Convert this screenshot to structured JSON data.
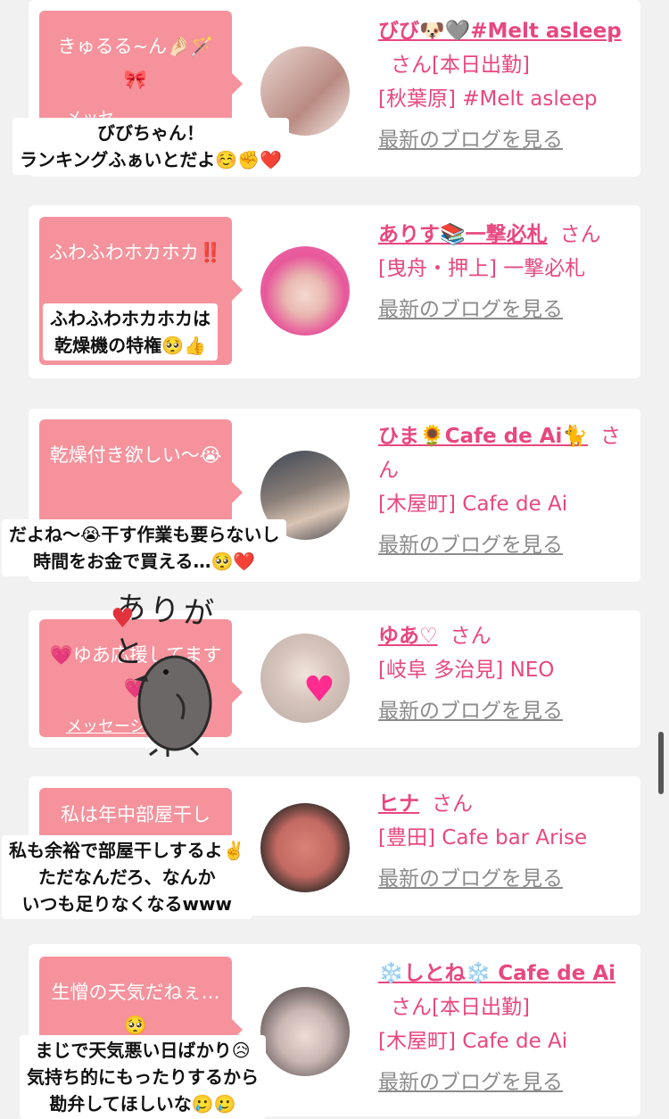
{
  "entries": [
    {
      "bubble_text": "きゅるる~ん🤌🏻🪄🎀",
      "bubble_link": "メッセ",
      "name": "びび🐶🩶#Melt asleep",
      "san": "さん[本日出勤]",
      "shop": "[秋葉原] #Melt asleep",
      "blog": "最新のブログを見る",
      "caption": "びびちゃん！\nランキングふぁいとだよ☺️✊❤️"
    },
    {
      "bubble_text": "ふわふわホカホカ‼️",
      "name": "ありす📚一撃必札",
      "san": "さん",
      "shop": "[曳舟・押上] 一撃必札",
      "blog": "最新のブログを見る",
      "caption": "ふわふわホカホカは\n乾燥機の特権🥺👍"
    },
    {
      "bubble_text": "乾燥付き欲しい〜😭",
      "name": "ひま🌻Cafe de Ai🐈",
      "san": "さん",
      "shop": "[木屋町] Cafe de Ai",
      "blog": "最新のブログを見る",
      "caption": "だよね〜😭干す作業も要らないし\n時間をお金で買える…🥺❤️"
    },
    {
      "bubble_text": "💗ゆあ応援してます💗",
      "bubble_link": "メッセージ",
      "name": "ゆあ♡",
      "san": "さん",
      "shop": "[岐阜 多治見] NEO",
      "blog": "最新のブログを見る",
      "sticker_text": "ありがと"
    },
    {
      "bubble_text": "私は年中部屋干し",
      "name": "ヒナ",
      "san": "さん",
      "shop": "[豊田] Cafe bar Arise",
      "blog": "最新のブログを見る",
      "caption": "私も余裕で部屋干しするよ✌️\nただなんだろ、なんか\nいつも足りなくなるwww"
    },
    {
      "bubble_text": "生憎の天気だねぇ…🥺",
      "name": "❄️しとね❄️ Cafe de Ai",
      "san": "さん[本日出勤]",
      "shop": "[木屋町] Cafe de Ai",
      "blog": "最新のブログを見る",
      "caption": "まじで天気悪い日ばかり😥\n気持ち的にもったりするから\n勘弁してほしいな🥲🥲"
    }
  ],
  "colors": {
    "accent": "#e8477f",
    "bubble": "#f5929c",
    "background": "#f2f1f1"
  }
}
